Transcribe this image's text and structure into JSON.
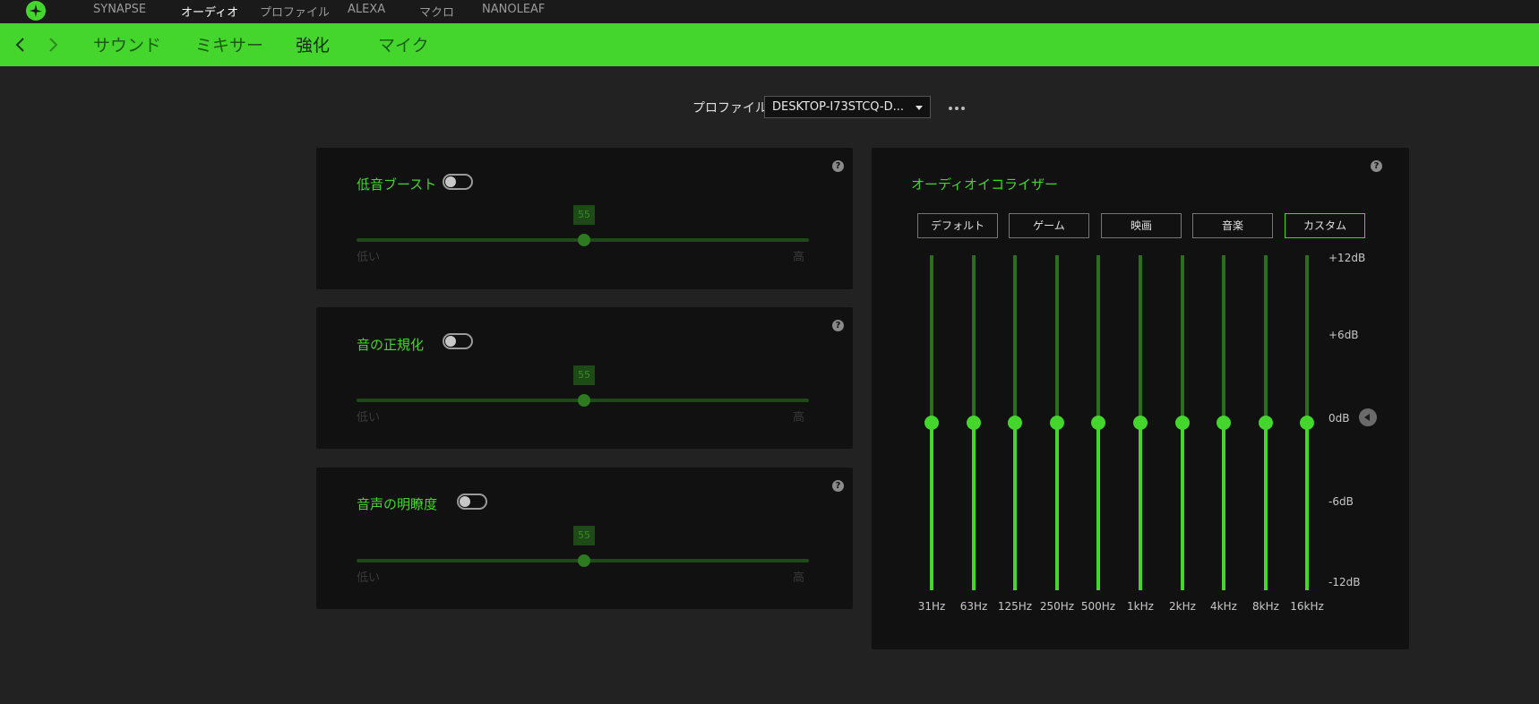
{
  "topnav": {
    "tabs": [
      {
        "label": "SYNAPSE"
      },
      {
        "label": "オーディオ"
      },
      {
        "label": "プロファイル"
      },
      {
        "label": "ALEXA"
      },
      {
        "label": "マクロ"
      },
      {
        "label": "NANOLEAF"
      }
    ],
    "active_tab": "オーディオ"
  },
  "subnav": {
    "tabs": [
      {
        "label": "サウンド"
      },
      {
        "label": "ミキサー"
      },
      {
        "label": "強化"
      },
      {
        "label": "マイク"
      }
    ],
    "active_tab": "強化"
  },
  "profile": {
    "label": "プロファイル",
    "value": "DESKTOP-I73STCQ-D..."
  },
  "enhancements": [
    {
      "title": "低音ブースト",
      "enabled": false,
      "value": "55",
      "min_label": "低い",
      "max_label": "高"
    },
    {
      "title": "音の正規化",
      "enabled": false,
      "value": "55",
      "min_label": "低い",
      "max_label": "高"
    },
    {
      "title": "音声の明瞭度",
      "enabled": false,
      "value": "55",
      "min_label": "低い",
      "max_label": "高"
    }
  ],
  "help_label": "?",
  "equalizer": {
    "title": "オーディオイコライザー",
    "presets": [
      {
        "label": "デフォルト"
      },
      {
        "label": "ゲーム"
      },
      {
        "label": "映画"
      },
      {
        "label": "音楽"
      },
      {
        "label": "カスタム"
      }
    ],
    "active_preset": "カスタム",
    "db_labels": [
      "+12dB",
      "+6dB",
      "0dB",
      "-6dB",
      "-12dB"
    ],
    "bands": [
      {
        "freq": "31Hz",
        "gain_db": 0
      },
      {
        "freq": "63Hz",
        "gain_db": 0
      },
      {
        "freq": "125Hz",
        "gain_db": 0
      },
      {
        "freq": "250Hz",
        "gain_db": 0
      },
      {
        "freq": "500Hz",
        "gain_db": 0
      },
      {
        "freq": "1kHz",
        "gain_db": 0
      },
      {
        "freq": "2kHz",
        "gain_db": 0
      },
      {
        "freq": "4kHz",
        "gain_db": 0
      },
      {
        "freq": "8kHz",
        "gain_db": 0
      },
      {
        "freq": "16kHz",
        "gain_db": 0
      }
    ]
  },
  "colors": {
    "accent": "#44d62c",
    "background": "#222222",
    "panel": "#111111"
  }
}
